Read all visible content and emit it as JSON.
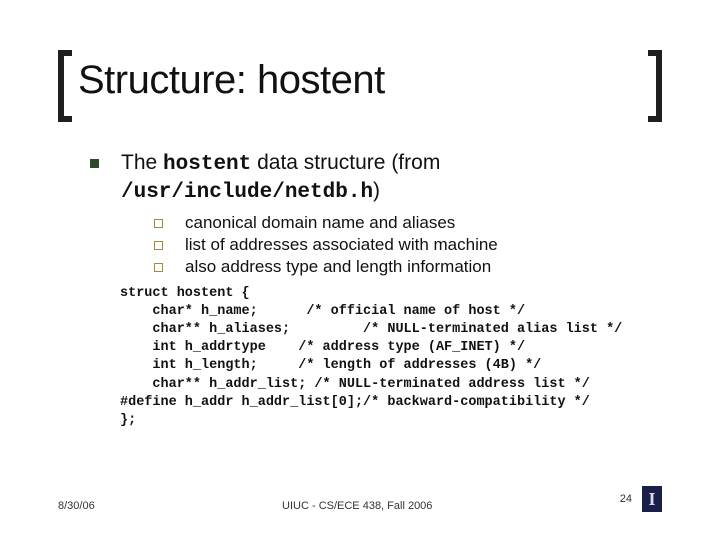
{
  "title": "Structure: hostent",
  "bullet": {
    "line1_pre": "The ",
    "line1_mono": "hostent",
    "line1_post": " data structure (from",
    "line2_mono": "/usr/include/netdb.h",
    "line2_post": ")",
    "subs": [
      "canonical domain name and aliases",
      "list of addresses associated with machine",
      "also address type and length information"
    ]
  },
  "code": "struct hostent {\n    char* h_name;      /* official name of host */\n    char** h_aliases;         /* NULL-terminated alias list */\n    int h_addrtype    /* address type (AF_INET) */\n    int h_length;     /* length of addresses (4B) */\n    char** h_addr_list; /* NULL-terminated address list */\n#define h_addr h_addr_list[0];/* backward-compatibility */\n};",
  "footer": {
    "date": "8/30/06",
    "center": "UIUC - CS/ECE 438, Fall 2006",
    "page": "24"
  }
}
